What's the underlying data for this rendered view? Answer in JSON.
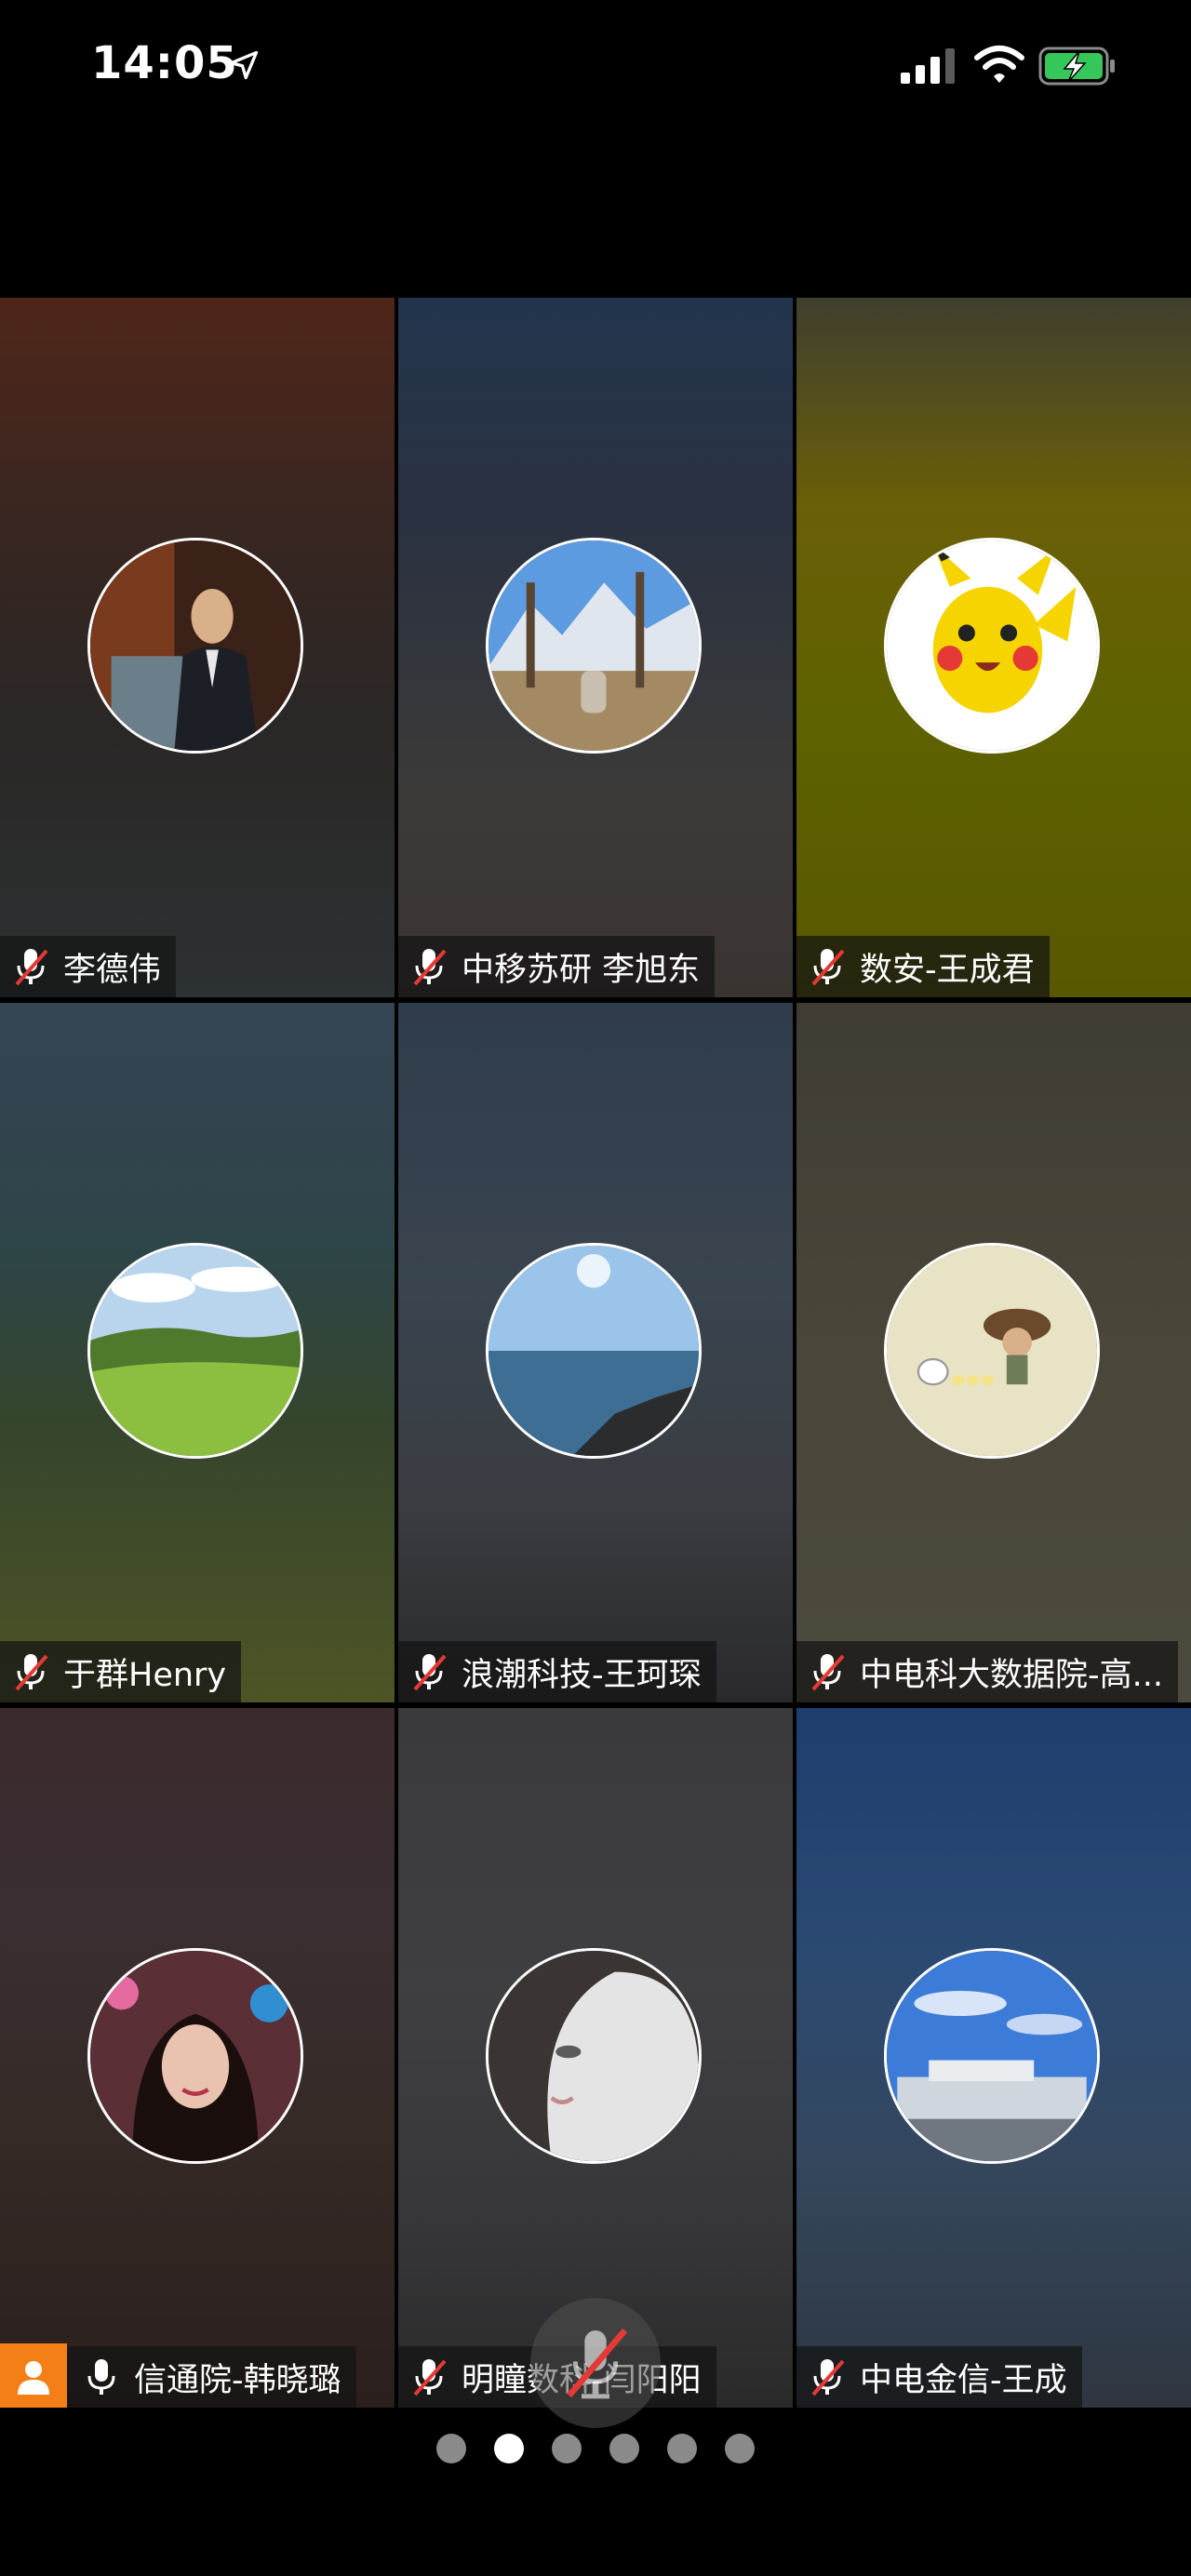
{
  "status_bar": {
    "time": "14:05"
  },
  "participants": [
    {
      "name": "李德伟",
      "mic": "muted"
    },
    {
      "name": "中移苏研 李旭东",
      "mic": "muted"
    },
    {
      "name": "数安-王成君",
      "mic": "muted"
    },
    {
      "name": "于群Henry",
      "mic": "muted"
    },
    {
      "name": "浪潮科技-王珂琛",
      "mic": "muted"
    },
    {
      "name": "中电科大数据院-高...",
      "mic": "muted"
    },
    {
      "name": "信通院-韩晓璐",
      "mic": "on",
      "is_host": true
    },
    {
      "name": "明瞳数科-闫阳阳",
      "mic": "muted"
    },
    {
      "name": "中电金信-王成",
      "mic": "muted"
    }
  ],
  "pager": {
    "count": 6,
    "active_index": 1
  },
  "colors": {
    "host_badge": "#f57f17",
    "mute_slash": "#e53935"
  }
}
